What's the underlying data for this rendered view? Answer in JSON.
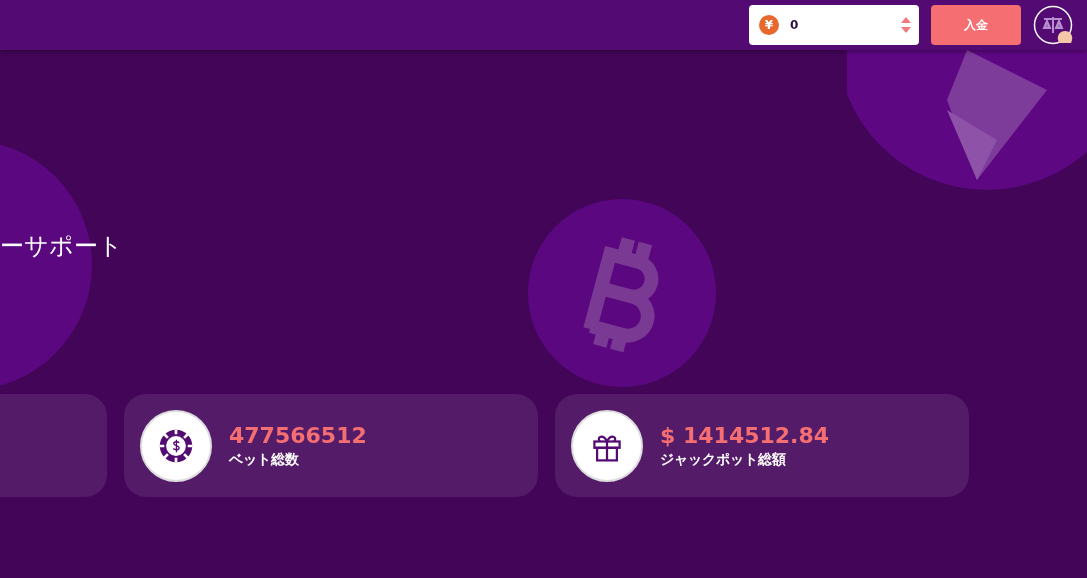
{
  "header": {
    "balance": {
      "currency_symbol": "¥",
      "value": "0"
    },
    "deposit_button": "入金"
  },
  "hero": {
    "heading": "ーサポート"
  },
  "stats": [
    {
      "kind": "empty"
    },
    {
      "kind": "chip",
      "value": "477566512",
      "label": "ベット総数"
    },
    {
      "kind": "gift",
      "value": "$ 1414512.84",
      "label": "ジャックポット総額"
    }
  ]
}
